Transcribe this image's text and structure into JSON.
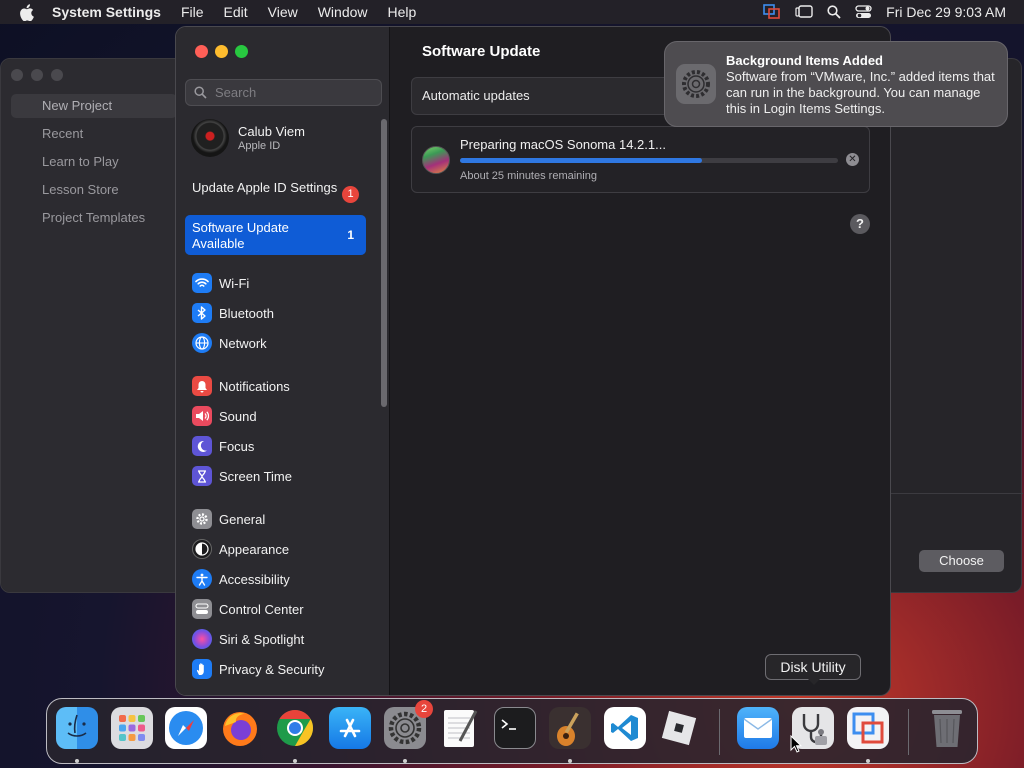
{
  "menubar": {
    "app_name": "System Settings",
    "menus": [
      "File",
      "Edit",
      "View",
      "Window",
      "Help"
    ],
    "clock": "Fri Dec 29  9:03 AM"
  },
  "bg_window": {
    "items": [
      "New Project",
      "Recent",
      "Learn to Play",
      "Lesson Store",
      "Project Templates"
    ],
    "choose_label": "Choose"
  },
  "sidebar": {
    "search_placeholder": "Search",
    "user_name": "Calub Viem",
    "user_sub": "Apple ID",
    "update_apple_id": "Update Apple ID Settings",
    "update_apple_id_badge": "1",
    "software_update": "Software Update Available",
    "software_update_count": "1",
    "items": [
      {
        "label": "Wi-Fi",
        "icon": "wifi-icon",
        "color": "#1e7cf5"
      },
      {
        "label": "Bluetooth",
        "icon": "bluetooth-icon",
        "color": "#1e7cf5"
      },
      {
        "label": "Network",
        "icon": "globe-icon",
        "color": "#1e7cf5"
      },
      {
        "label": "Notifications",
        "icon": "bell-icon",
        "color": "#ea4a43"
      },
      {
        "label": "Sound",
        "icon": "speaker-icon",
        "color": "#ea4a5e"
      },
      {
        "label": "Focus",
        "icon": "moon-icon",
        "color": "#5e55d6"
      },
      {
        "label": "Screen Time",
        "icon": "hourglass-icon",
        "color": "#5e55d6"
      },
      {
        "label": "General",
        "icon": "gear-icon",
        "color": "#8e8e93"
      },
      {
        "label": "Appearance",
        "icon": "appearance-icon",
        "color": "#1c1c1e"
      },
      {
        "label": "Accessibility",
        "icon": "accessibility-icon",
        "color": "#1e7cf5"
      },
      {
        "label": "Control Center",
        "icon": "control-center-icon",
        "color": "#8e8e93"
      },
      {
        "label": "Siri & Spotlight",
        "icon": "siri-icon",
        "color": "#7d4ee0"
      },
      {
        "label": "Privacy & Security",
        "icon": "hand-icon",
        "color": "#1e7cf5"
      }
    ]
  },
  "content": {
    "title": "Software Update",
    "automatic_updates": "Automatic updates",
    "update_title": "Preparing macOS Sonoma 14.2.1...",
    "update_progress": 0.64,
    "update_remaining": "About 25 minutes remaining",
    "help": "?"
  },
  "notification": {
    "title": "Background Items Added",
    "body": "Software from “VMware, Inc.” added items that can run in the background. You can manage this in Login Items Settings."
  },
  "tooltip": "Disk Utility",
  "dock": {
    "settings_badge": "2",
    "apps": [
      "Finder",
      "Launchpad",
      "Safari",
      "Firefox",
      "Chrome",
      "App Store",
      "System Settings",
      "TextEdit",
      "Terminal",
      "GarageBand",
      "Visual Studio Code",
      "Roblox",
      "Mail",
      "Disk Utility",
      "VMware Fusion",
      "Trash"
    ]
  }
}
